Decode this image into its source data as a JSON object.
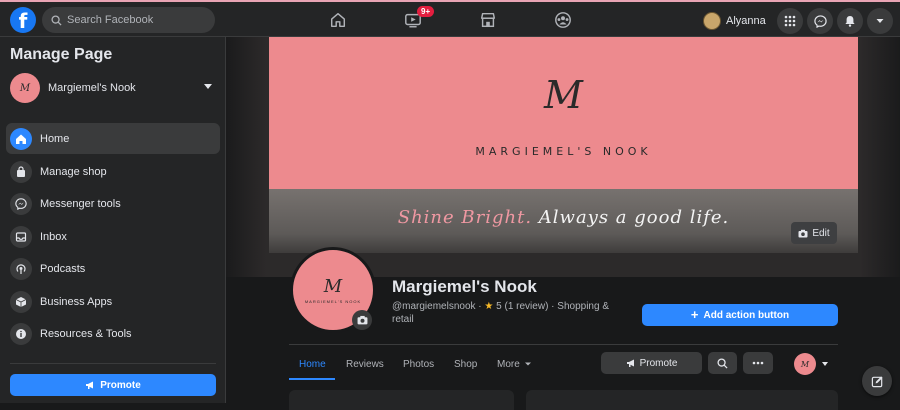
{
  "topbar": {
    "logo": "f",
    "search_placeholder": "Search Facebook",
    "watch_badge": "9+",
    "user_name": "Alyanna",
    "icons": [
      "home-icon",
      "watch-icon",
      "marketplace-icon",
      "groups-icon",
      "menu-grid-icon",
      "messenger-icon",
      "notifications-icon",
      "account-caret-icon"
    ]
  },
  "sidebar": {
    "title": "Manage Page",
    "page_name": "Margiemel's Nook",
    "items": [
      {
        "label": "Home",
        "icon": "home-icon",
        "active": true
      },
      {
        "label": "Manage shop",
        "icon": "shop-bag-icon"
      },
      {
        "label": "Messenger tools",
        "icon": "messenger-icon"
      },
      {
        "label": "Inbox",
        "icon": "inbox-icon"
      },
      {
        "label": "Podcasts",
        "icon": "podcast-icon"
      },
      {
        "label": "Business Apps",
        "icon": "cube-icon"
      },
      {
        "label": "Resources & Tools",
        "icon": "info-icon"
      }
    ],
    "promote_label": "Promote"
  },
  "cover": {
    "script_mark": "M",
    "brand_name": "MARGIEMEL'S NOOK",
    "tagline_pink": "Shine Bright.",
    "tagline_white": "Always a good life.",
    "edit_label": "Edit"
  },
  "profile": {
    "pic_script": "M",
    "pic_name": "MARGIEMEL'S NOOK",
    "page_name": "Margiemel's Nook",
    "meta_handle": "@margiemelsnook · ",
    "meta_rating": "5 (1 review) · Shopping & retail",
    "action_button_label": "Add action button"
  },
  "tabs": {
    "items": [
      "Home",
      "Reviews",
      "Photos",
      "Shop",
      "More"
    ],
    "active": "Home",
    "promote_label": "Promote"
  },
  "colors": {
    "accent": "#2d88ff",
    "brand_pink": "#ed8a8e",
    "background": "#18191a",
    "surface": "#242526"
  }
}
